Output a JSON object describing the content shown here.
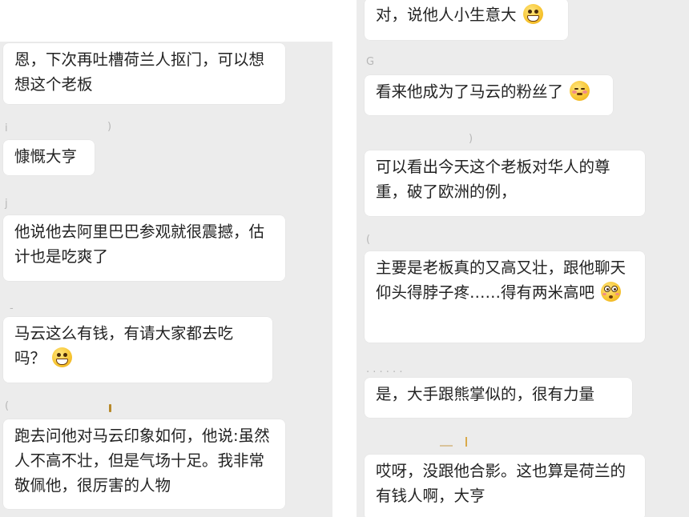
{
  "left_column": {
    "messages": [
      {
        "text": "恩，下次再吐槽荷兰人抠门，可以想想这个老板"
      },
      {
        "text": "慷慨大亨"
      },
      {
        "text": "他说他去阿里巴巴参观就很震撼，估计也是吃爽了"
      },
      {
        "text": "马云这么有钱，有请大家都去吃吗？",
        "emoji": "grin-emoji"
      },
      {
        "text": "跑去问他对马云印象如何，他说:虽然人不高不壮，但是气场十足。我非常敬佩他，很厉害的人物"
      }
    ],
    "faint_marks": [
      "i",
      ")",
      "j",
      "-",
      "("
    ]
  },
  "right_column": {
    "messages": [
      {
        "text": "对，说他人小生意大",
        "emoji": "grin-emoji"
      },
      {
        "text": "看来他成为了马云的粉丝了",
        "emoji": "shy-smile-emoji"
      },
      {
        "text": "可以看出今天这个老板对华人的尊重，破了欧洲的例，"
      },
      {
        "text": "主要是老板真的又高又壮，跟他聊天仰头得脖子疼……得有两米高吧",
        "emoji": "flushed-emoji"
      },
      {
        "text": "是，大手跟熊掌似的，很有力量"
      },
      {
        "text": "哎呀，没跟他合影。这也算是荷兰的有钱人啊，大亨"
      }
    ],
    "faint_marks": [
      "G",
      ")",
      "(",
      ". . . . . ."
    ]
  },
  "colors": {
    "chat_background": "#ececec",
    "bubble_background": "#ffffff",
    "message_text": "#222222",
    "page_background": "#ffffff"
  }
}
